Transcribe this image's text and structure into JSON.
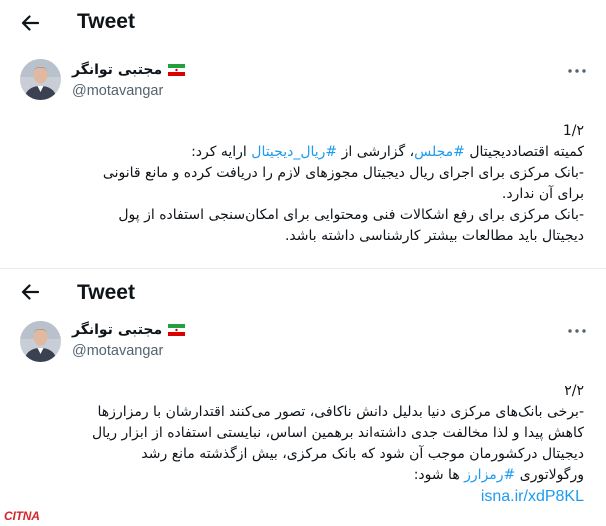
{
  "watermark": {
    "text": "CITNA"
  },
  "panels": [
    {
      "header": {
        "title": "Tweet"
      },
      "author": {
        "name": "مجتبی توانگر",
        "handle": "@motavangar"
      },
      "tweet": {
        "number": "1/۲",
        "line1_pre": "کمیته اقتصاددیجیتال ",
        "tag1": "#مجلس",
        "line1_mid": "، گزارشی از ",
        "tag2": "#ریال_دیجیتال",
        "line1_post": " ارایه کرد:",
        "line2": "-بانک مرکزی برای اجرای ریال دیجیتال مجوزهای لازم را دریافت کرده و مانع قانونی برای آن ندارد.",
        "line3": "-بانک مرکزی برای رفع اشکالات فنی ومحتوایی برای امکان‌سنجی استفاده از پول دیجیتال باید مطالعات بیشتر کارشناسی داشته باشد."
      }
    },
    {
      "header": {
        "title": "Tweet"
      },
      "author": {
        "name": "مجتبی توانگر",
        "handle": "@motavangar"
      },
      "tweet": {
        "number": "۲/۲",
        "body": "-برخی بانک‌های مرکزی دنیا بدلیل دانش ناکافی، تصور می‌کنند اقتدارشان با رمزارزها کاهش پیدا و لذا مخالفت جدی داشته‌اند برهمین اساس، نبایستی استفاده از ابزار ریال دیجیتال درکشورمان موجب آن شود که بانک مرکزی، بیش ازگذشته مانع رشد",
        "last_pre": "ورگولاتوری ",
        "tag": "#رمزارز",
        "last_post": " ها شود:",
        "link": "isna.ir/xdP8KL"
      }
    }
  ]
}
